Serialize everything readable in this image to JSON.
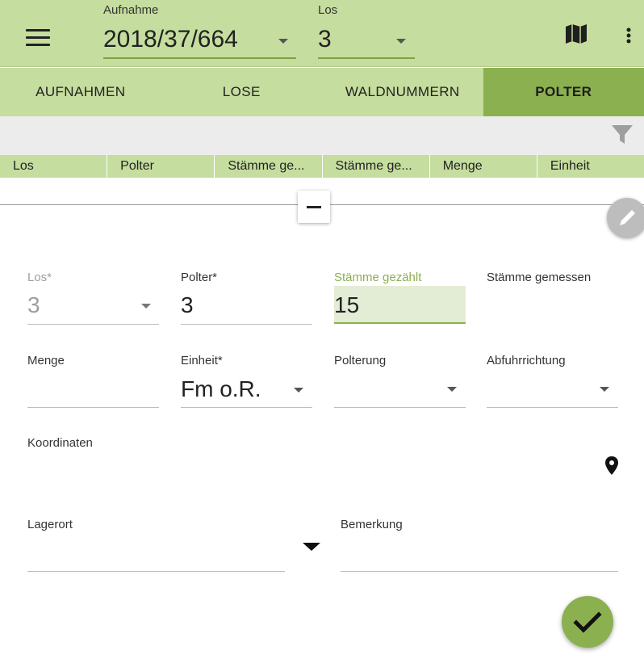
{
  "appbar": {
    "aufnahme": {
      "label": "Aufnahme",
      "value": "2018/37/664"
    },
    "los": {
      "label": "Los",
      "value": "3"
    },
    "icons": [
      "menu-icon",
      "map-icon",
      "more-vert-icon"
    ]
  },
  "tabs": [
    {
      "label": "AUFNAHMEN",
      "active": false
    },
    {
      "label": "LOSE",
      "active": false
    },
    {
      "label": "WALDNUMMERN",
      "active": false
    },
    {
      "label": "POLTER",
      "active": true
    }
  ],
  "filter": {
    "icon": "filter-icon"
  },
  "table": {
    "columns": [
      "Los",
      "Polter",
      "Stämme ge...",
      "Stämme ge...",
      "Menge",
      "Einheit"
    ]
  },
  "form": {
    "los": {
      "label": "Los*",
      "value": "3"
    },
    "polter": {
      "label": "Polter*",
      "value": "3"
    },
    "staemme_gezaehlt": {
      "label": "Stämme gezählt",
      "value": "15"
    },
    "staemme_gemessen": {
      "label": "Stämme gemessen",
      "value": ""
    },
    "menge": {
      "label": "Menge",
      "value": ""
    },
    "einheit": {
      "label": "Einheit*",
      "value": "Fm o.R."
    },
    "polterung": {
      "label": "Polterung",
      "value": ""
    },
    "abfuhrrichtung": {
      "label": "Abfuhrrichtung",
      "value": ""
    },
    "koordinaten": {
      "label": "Koordinaten",
      "value": ""
    },
    "lagerort": {
      "label": "Lagerort",
      "value": ""
    },
    "bemerkung": {
      "label": "Bemerkung",
      "value": ""
    }
  },
  "colors": {
    "primary_light": "#c5dd9e",
    "primary": "#8bb04f",
    "focused_bg": "#e3ecd5",
    "filter_bg": "#ececec"
  }
}
